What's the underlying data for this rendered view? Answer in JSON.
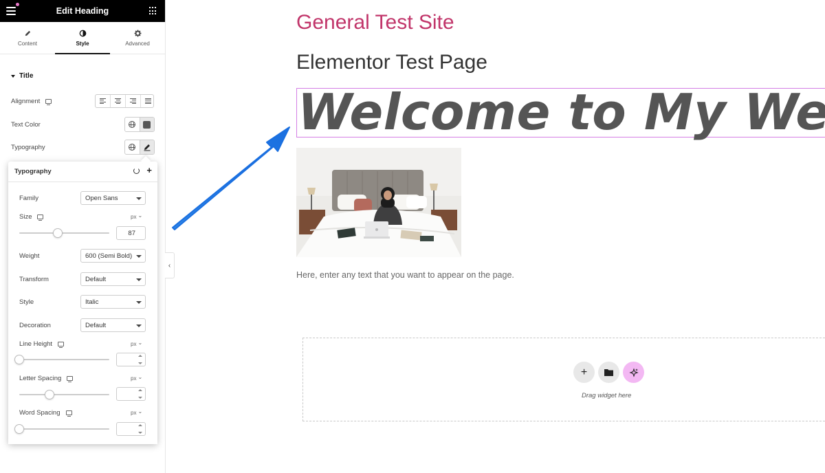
{
  "panel": {
    "title": "Edit Heading",
    "tabs": [
      {
        "label": "Content",
        "icon": "pencil-icon"
      },
      {
        "label": "Style",
        "icon": "contrast-icon"
      },
      {
        "label": "Advanced",
        "icon": "gear-icon"
      }
    ],
    "active_tab": "Style",
    "section": "Title",
    "controls": {
      "alignment_label": "Alignment",
      "text_color_label": "Text Color",
      "typography_label": "Typography"
    },
    "accent_color": "#d47ee5"
  },
  "typography": {
    "title": "Typography",
    "family_label": "Family",
    "family_value": "Open Sans",
    "size_label": "Size",
    "size_unit": "px",
    "size_value": "87",
    "weight_label": "Weight",
    "weight_value": "600 (Semi Bold)",
    "transform_label": "Transform",
    "transform_value": "Default",
    "style_label": "Style",
    "style_value": "Italic",
    "decoration_label": "Decoration",
    "decoration_value": "Default",
    "line_height_label": "Line Height",
    "line_height_unit": "px",
    "letter_spacing_label": "Letter Spacing",
    "letter_spacing_unit": "px",
    "word_spacing_label": "Word Spacing",
    "word_spacing_unit": "px"
  },
  "canvas": {
    "site_title": "General Test Site",
    "site_title_color": "#c1356a",
    "page_title": "Elementor Test Page",
    "heading": "Welcome to My Website",
    "body_text": "Here, enter any text that you want to appear on the page.",
    "drop_text": "Drag widget here"
  }
}
